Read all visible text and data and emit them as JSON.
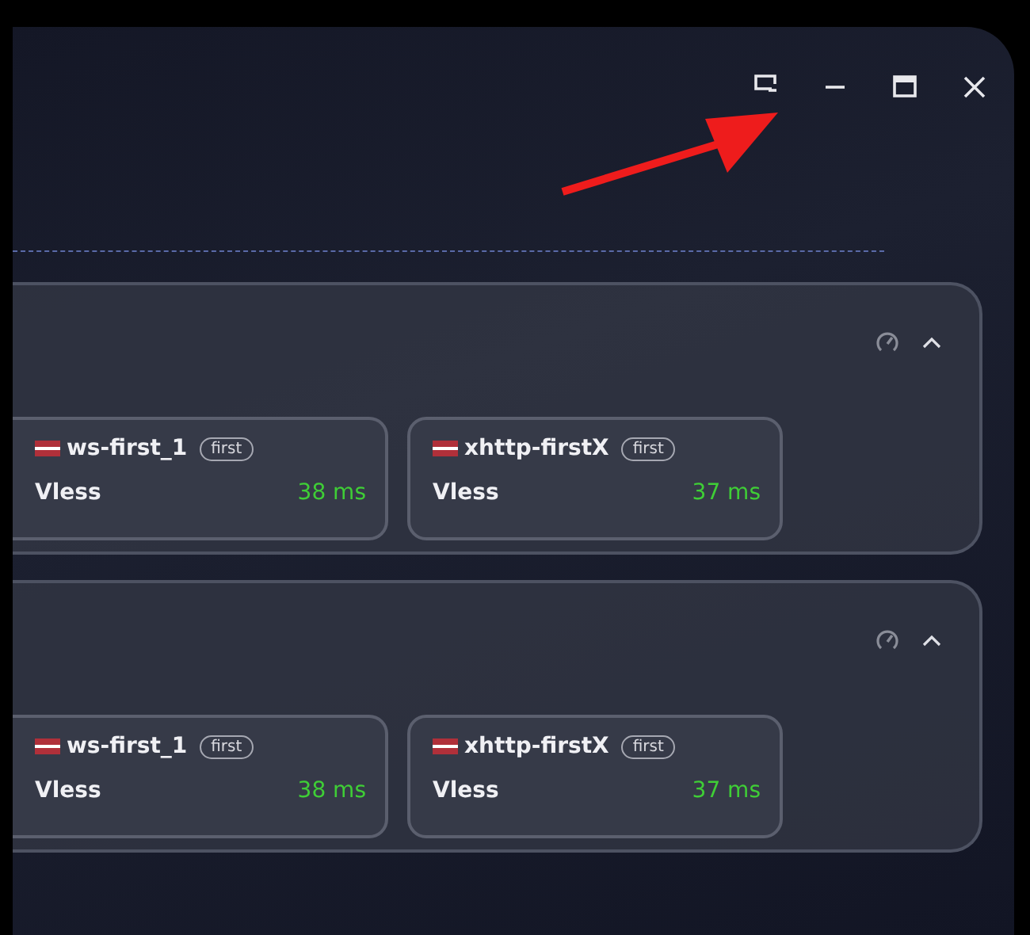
{
  "window_controls": [
    {
      "kind": "pip"
    },
    {
      "kind": "minimize"
    },
    {
      "kind": "maximize"
    },
    {
      "kind": "close"
    }
  ],
  "annotation": {
    "kind": "arrow",
    "color": "#ee1c1c"
  },
  "groups": [
    {
      "expanded": true,
      "cards": [
        {
          "name": "ws-first_1",
          "tag": "first",
          "protocol": "Vless",
          "latency": "38 ms"
        },
        {
          "name": "xhttp-firstX",
          "tag": "first",
          "protocol": "Vless",
          "latency": "37 ms"
        }
      ]
    },
    {
      "expanded": true,
      "cards": [
        {
          "name": "ws-first_1",
          "tag": "first",
          "protocol": "Vless",
          "latency": "38 ms"
        },
        {
          "name": "xhttp-firstX",
          "tag": "first",
          "protocol": "Vless",
          "latency": "37 ms"
        }
      ]
    }
  ]
}
